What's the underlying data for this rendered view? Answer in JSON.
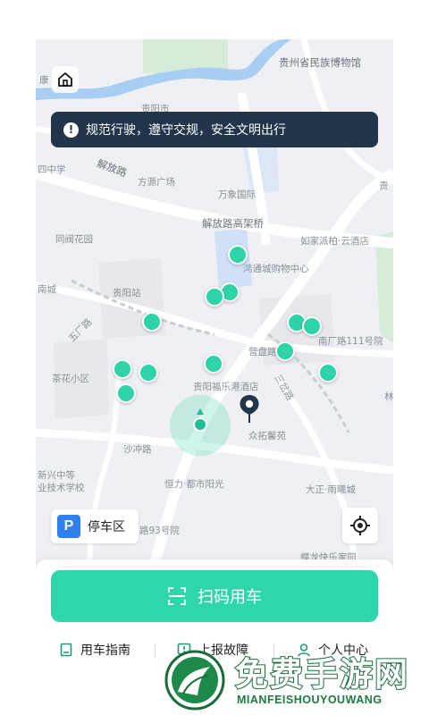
{
  "notice": {
    "text": "规范行驶，遵守交规，安全文明出行",
    "icon": "exclamation-icon"
  },
  "map_labels": {
    "museum": "贵州省民族博物馆",
    "kang": "康",
    "guiyang_city_area": "贵阳市",
    "jiefang_road": "解放路",
    "school_40": "四中学",
    "fangyuan": "方源广场",
    "wanxiang": "万象国际",
    "gui_right": "贵",
    "jiefang_bridge": "解放路高架桥",
    "tonghe": "同阀花园",
    "rujia": "如家派柏·云酒店",
    "hongtong": "鸿通城购物中心",
    "nancheng": "南城",
    "guiyang_station": "贵阳站",
    "wuchang": "五厂路",
    "nanchang_111": "南厂路111号院",
    "chahua": "茶花小区",
    "yingpan": "营盘路",
    "sanjiao": "三岔路",
    "fuleGang": "贵阳福乐港酒店",
    "lin": "林",
    "zhongtuo": "众拓馨苑",
    "shachong": "沙冲路",
    "xinxing": "新兴中等",
    "jishu": "业技术学校",
    "hengli": "恒力·都市阳光",
    "dazheng": "大正·雨曦城",
    "no93": "路93号院",
    "jiayuan": "蝶龙快乐家园"
  },
  "parking": {
    "badge": "P",
    "label": "停车区"
  },
  "scan": {
    "label": "扫码用车"
  },
  "nav": {
    "guide": "用车指南",
    "report": "上报故障",
    "profile": "个人中心"
  },
  "watermark": {
    "title": "免费手游网",
    "subtitle": "MIANFEISHOUYOUWANG"
  },
  "colors": {
    "accent": "#2ed6ab",
    "notice_bg": "#22354a",
    "parking_blue": "#2f80ed"
  }
}
